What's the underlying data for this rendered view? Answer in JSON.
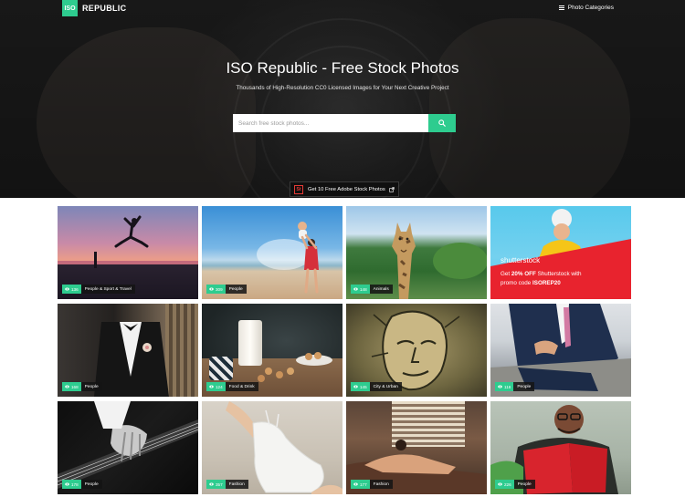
{
  "header": {
    "logo_mark": "ISO",
    "logo_text": "REPUBLIC",
    "nav_label": "Photo Categories"
  },
  "hero": {
    "title": "ISO Republic - Free Stock Photos",
    "subtitle": "Thousands of High-Resolution CC0 Licensed Images for Your Next Creative Project",
    "search_placeholder": "Search free stock photos...",
    "promo_mark": "St",
    "promo_text": "Get 10 Free Adobe Stock Photos"
  },
  "ad": {
    "brand": "shutterstock",
    "line1_pre": "Get ",
    "line1_bold": "20% OFF",
    "line1_post": " Shutterstock with",
    "line2_pre": "promo code ",
    "line2_bold": "ISOREP20"
  },
  "photos": [
    {
      "count": "136",
      "category": "People & Sport & Travel"
    },
    {
      "count": "309",
      "category": "People"
    },
    {
      "count": "148",
      "category": "Animals"
    },
    {
      "count": "168",
      "category": "People"
    },
    {
      "count": "124",
      "category": "Food & Drink"
    },
    {
      "count": "145",
      "category": "City & Urban"
    },
    {
      "count": "116",
      "category": "People"
    },
    {
      "count": "178",
      "category": "People"
    },
    {
      "count": "357",
      "category": "Fashion"
    },
    {
      "count": "177",
      "category": "Fashion"
    },
    {
      "count": "226",
      "category": "People"
    }
  ],
  "colors": {
    "accent": "#2ecc8f",
    "ad_red": "#e8232e"
  }
}
